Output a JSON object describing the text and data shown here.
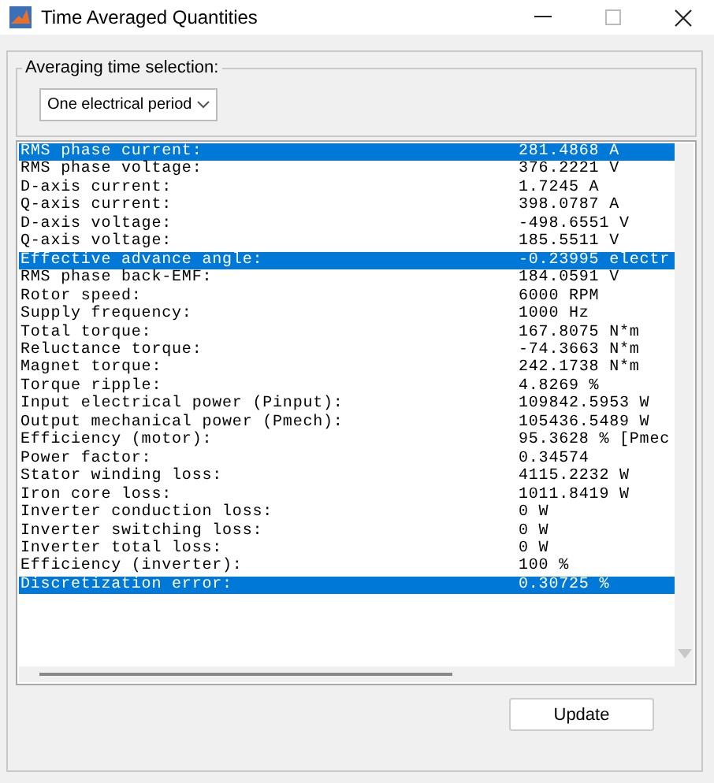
{
  "window": {
    "title": "Time Averaged Quantities",
    "maximize_disabled": true
  },
  "averaging": {
    "label": "Averaging time selection:",
    "value": "One electrical period"
  },
  "results": [
    {
      "label": "RMS phase current:",
      "value": "281.4868 A",
      "selected": true
    },
    {
      "label": "RMS phase voltage:",
      "value": "376.2221 V",
      "selected": false
    },
    {
      "label": "D-axis current:",
      "value": "1.7245 A",
      "selected": false
    },
    {
      "label": "Q-axis current:",
      "value": "398.0787 A",
      "selected": false
    },
    {
      "label": "D-axis voltage:",
      "value": "-498.6551 V",
      "selected": false
    },
    {
      "label": "Q-axis voltage:",
      "value": "185.5511 V",
      "selected": false
    },
    {
      "label": "Effective advance angle:",
      "value": "-0.23995 electr",
      "selected": true
    },
    {
      "label": "RMS phase back-EMF:",
      "value": "184.0591 V",
      "selected": false
    },
    {
      "label": "Rotor speed:",
      "value": "6000 RPM",
      "selected": false
    },
    {
      "label": "Supply frequency:",
      "value": "1000 Hz",
      "selected": false
    },
    {
      "label": "Total torque:",
      "value": "167.8075 N*m",
      "selected": false
    },
    {
      "label": "Reluctance torque:",
      "value": "-74.3663 N*m",
      "selected": false
    },
    {
      "label": "Magnet torque:",
      "value": "242.1738 N*m",
      "selected": false
    },
    {
      "label": "Torque ripple:",
      "value": "4.8269 %",
      "selected": false
    },
    {
      "label": "Input electrical power (Pinput):",
      "value": "109842.5953 W",
      "selected": false
    },
    {
      "label": "Output mechanical power (Pmech):",
      "value": "105436.5489 W",
      "selected": false
    },
    {
      "label": "Efficiency (motor):",
      "value": "95.3628 % [Pmec",
      "selected": false
    },
    {
      "label": "Power factor:",
      "value": "0.34574",
      "selected": false
    },
    {
      "label": "Stator winding loss:",
      "value": "4115.2232 W",
      "selected": false
    },
    {
      "label": "Iron core loss:",
      "value": "1011.8419 W",
      "selected": false
    },
    {
      "label": "Inverter conduction loss:",
      "value": "0 W",
      "selected": false
    },
    {
      "label": "Inverter switching loss:",
      "value": "0 W",
      "selected": false
    },
    {
      "label": "Inverter total loss:",
      "value": "0 W",
      "selected": false
    },
    {
      "label": "Efficiency (inverter):",
      "value": "100 %",
      "selected": false
    },
    {
      "label": "Discretization error:",
      "value": "0.30725 %",
      "selected": true
    }
  ],
  "buttons": [
    {
      "label": "Update"
    }
  ]
}
